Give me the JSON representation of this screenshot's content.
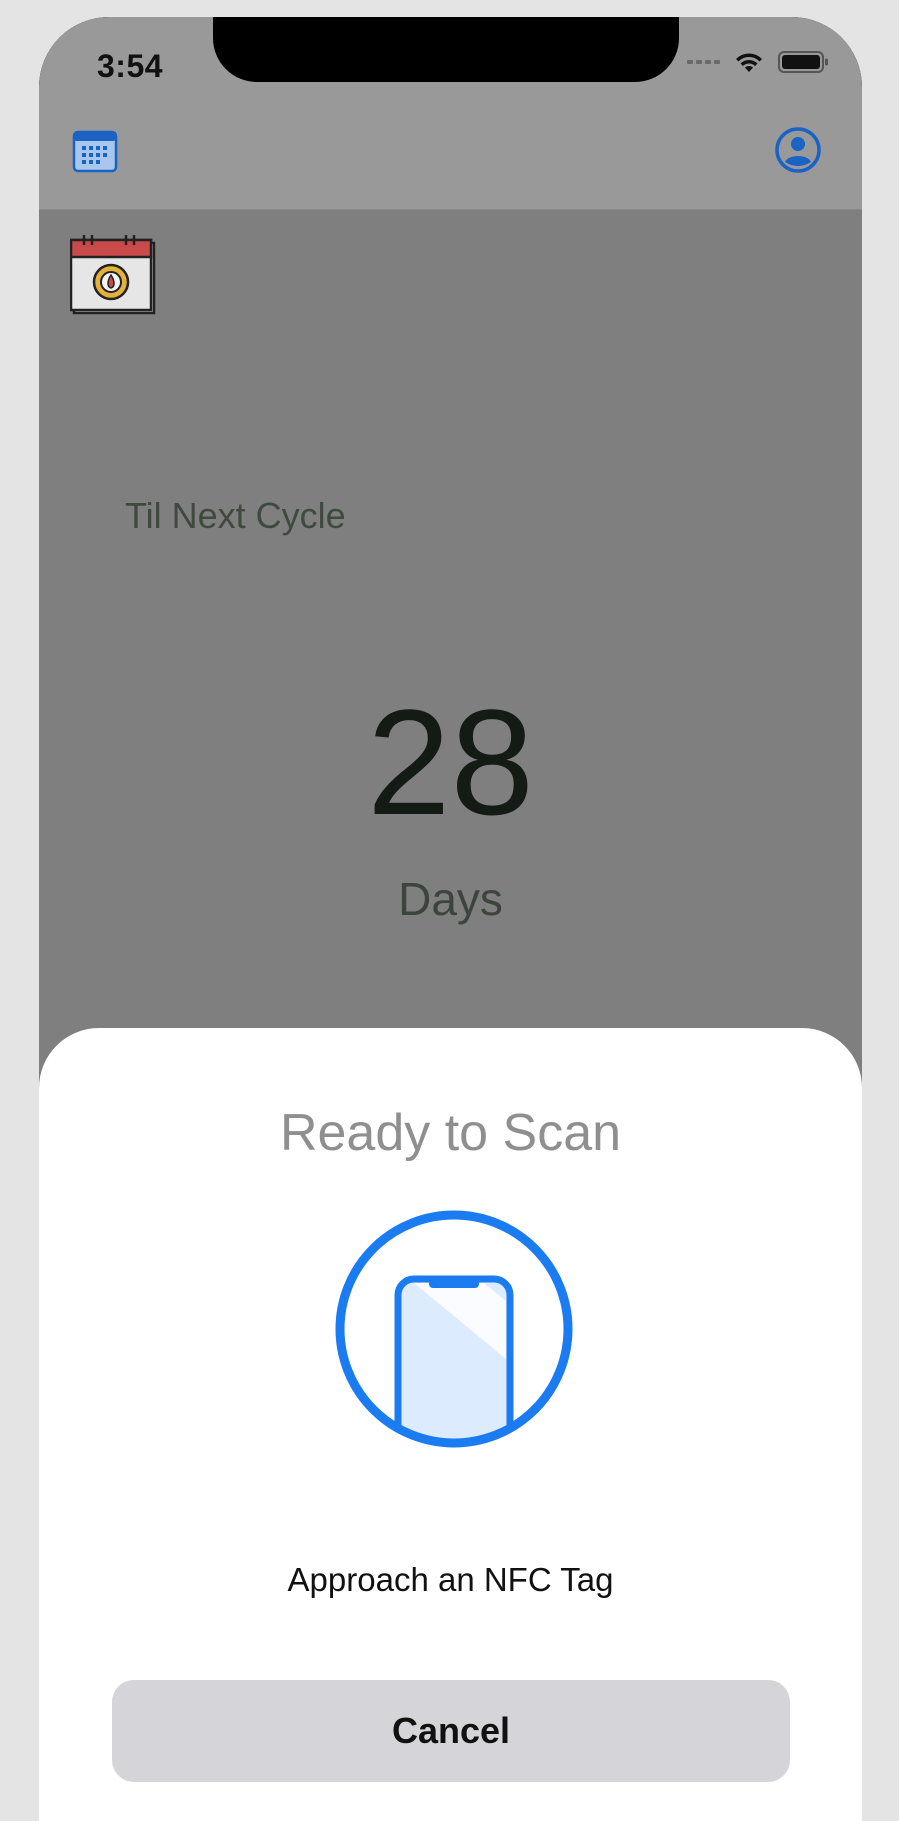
{
  "status_bar": {
    "time": "3:54"
  },
  "nav": {
    "left_icon": "calendar-icon",
    "right_icon": "profile-icon"
  },
  "main": {
    "cycle_icon": "cycle-calendar-icon",
    "til_label": "Til Next Cycle",
    "days_count": "28",
    "days_label": "Days"
  },
  "sheet": {
    "title": "Ready to Scan",
    "graphic_icon": "phone-scan-icon",
    "message": "Approach an NFC Tag",
    "cancel_label": "Cancel"
  },
  "colors": {
    "accent": "#1a7cf0",
    "dim_overlay": "#7f7f7f",
    "sheet_bg": "#ffffff",
    "button_bg": "#d4d4d9"
  }
}
